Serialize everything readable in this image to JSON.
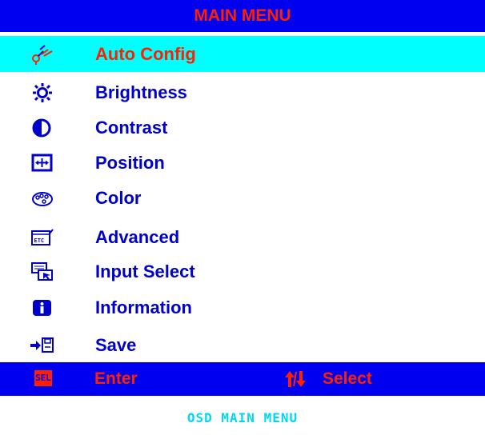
{
  "menu": {
    "title": "MAIN MENU",
    "items": [
      {
        "label": "Auto Config",
        "icon": "auto-config-icon",
        "selected": true
      },
      {
        "label": "Brightness",
        "icon": "brightness-sun-icon",
        "selected": false
      },
      {
        "label": "Contrast",
        "icon": "contrast-half-circle-icon",
        "selected": false
      },
      {
        "label": "Position",
        "icon": "position-arrows-icon",
        "selected": false
      },
      {
        "label": "Color",
        "icon": "color-palette-icon",
        "selected": false
      },
      {
        "label": "Advanced",
        "icon": "etc-advanced-icon",
        "selected": false
      },
      {
        "label": "Input Select",
        "icon": "input-select-icon",
        "selected": false
      },
      {
        "label": "Information",
        "icon": "information-icon",
        "selected": false
      },
      {
        "label": "Save",
        "icon": "save-disk-icon",
        "selected": false
      }
    ]
  },
  "footer": {
    "sel_key": "SEL",
    "enter_label": "Enter",
    "select_label": "Select"
  },
  "caption": "OSD MAIN MENU",
  "colors": {
    "bar_blue": "#0000f0",
    "highlight_cyan": "#00ffff",
    "accent_red": "#ff2000",
    "label_blue": "#0000c8",
    "caption_cyan": "#00d8f0"
  }
}
